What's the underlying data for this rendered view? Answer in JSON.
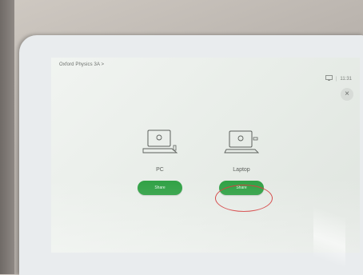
{
  "header": {
    "room_name": "Oxford Physics 3A >",
    "status_icon": "screen-share-icon",
    "time": "11:31"
  },
  "close": {
    "icon": "close-icon",
    "glyph": "×"
  },
  "devices": [
    {
      "icon": "pc-monitor-icon",
      "label": "PC",
      "button": "Share"
    },
    {
      "icon": "laptop-icon",
      "label": "Laptop",
      "button": "Share"
    }
  ],
  "colors": {
    "accent": "#2ea043",
    "highlight": "#d23a3a"
  }
}
